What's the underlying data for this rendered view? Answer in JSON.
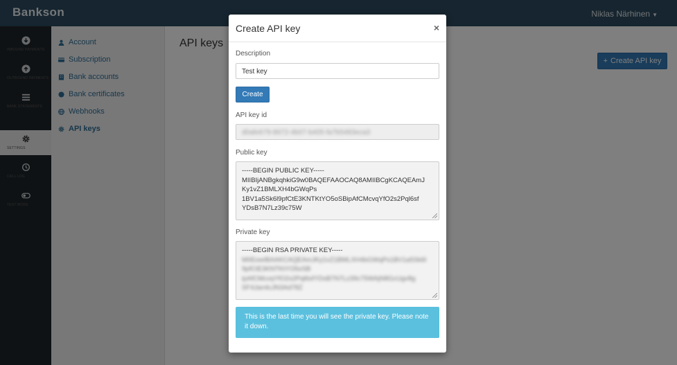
{
  "app": {
    "brand": "Bankson",
    "user": "Niklas Närhinen"
  },
  "leftnav": [
    {
      "label": "Inbound payments",
      "icon": "arrow-down-circle-icon"
    },
    {
      "label": "Outbound payments",
      "icon": "arrow-up-circle-icon"
    },
    {
      "label": "Bank statements",
      "icon": "list-icon"
    },
    {
      "label": "Settings",
      "icon": "gear-icon",
      "active": true
    },
    {
      "label": "Call log",
      "icon": "history-icon"
    },
    {
      "label": "Test mode",
      "icon": "toggle-icon"
    }
  ],
  "submenu": [
    {
      "label": "Account",
      "icon": "user-icon"
    },
    {
      "label": "Subscription",
      "icon": "card-icon"
    },
    {
      "label": "Bank accounts",
      "icon": "bank-icon"
    },
    {
      "label": "Bank certificates",
      "icon": "certificate-icon"
    },
    {
      "label": "Webhooks",
      "icon": "globe-icon"
    },
    {
      "label": "API keys",
      "icon": "gear-icon",
      "active": true
    }
  ],
  "main": {
    "title": "API keys",
    "create_button": "Create API key"
  },
  "modal": {
    "title": "Create API key",
    "close": "×",
    "description_label": "Description",
    "description_value": "Test key",
    "create_label": "Create",
    "key_id_label": "API key id",
    "key_id_value": "d0afe679-8672-4b07-b405-fa7b5483eca3",
    "public_key_label": "Public key",
    "public_key_lines": [
      "-----BEGIN PUBLIC KEY-----",
      "MIIBIjANBgkqhkiG9w0BAQEFAAOCAQ8AMIIBCgKCAQEAmJ",
      "Ky1vZ1BMLXH4bGWqPs",
      "1BV1a5Sk6l9pfCtE3KNTKtYO5oSBipAfCMcvqYfO2s2Pql6sf",
      "YDsB7N7Lz39c75W"
    ],
    "private_key_label": "Private key",
    "private_key_header": "-----BEGIN RSA PRIVATE KEY-----",
    "private_key_lines": [
      "MIIEowIBAAKCAQEAmJKy1vZ1BMLXH4bGWqPs1BV1a5Sk6l",
      "9pfCtE3KNTKtYO5oSB",
      "ipAfCMcvqYfO2s2Pql6sfYDsB7N7Lz39c75WAjN8GcUgv8g",
      "SF4Jan4cJN3Ad78Z"
    ],
    "alert": "This is the last time you will see the private key. Please note it down."
  },
  "colors": {
    "primary": "#337ab7",
    "info": "#5bc0de",
    "topbar": "#2c4a5e",
    "sidebar": "#1f2529"
  }
}
